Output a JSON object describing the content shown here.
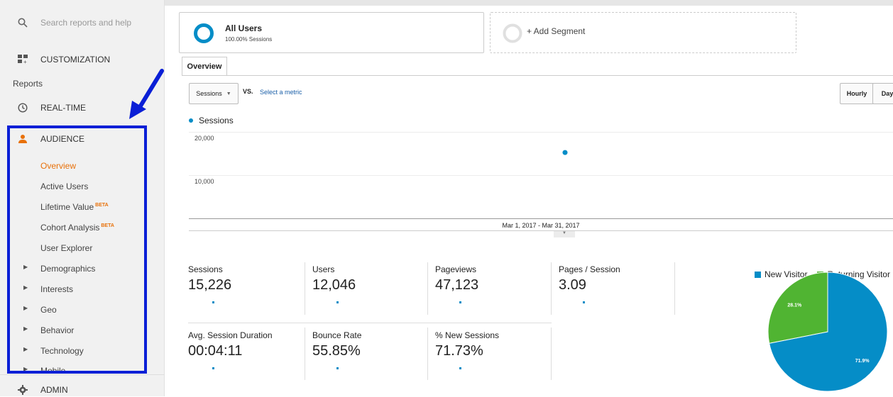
{
  "sidebar": {
    "search_placeholder": "Search reports and help",
    "customization": "CUSTOMIZATION",
    "reports_heading": "Reports",
    "realtime": "REAL-TIME",
    "audience": "AUDIENCE",
    "audience_items": [
      {
        "label": "Overview",
        "active": true
      },
      {
        "label": "Active Users"
      },
      {
        "label": "Lifetime Value",
        "badge": "BETA"
      },
      {
        "label": "Cohort Analysis",
        "badge": "BETA"
      },
      {
        "label": "User Explorer"
      },
      {
        "label": "Demographics"
      },
      {
        "label": "Interests"
      },
      {
        "label": "Geo"
      },
      {
        "label": "Behavior"
      },
      {
        "label": "Technology"
      },
      {
        "label": "Mobile"
      }
    ],
    "admin": "ADMIN"
  },
  "segments": {
    "all_users": "All Users",
    "all_users_sub": "100.00% Sessions",
    "add_segment": "+ Add Segment"
  },
  "tabs": {
    "overview": "Overview"
  },
  "controls": {
    "metric_select": "Sessions",
    "vs": "VS.",
    "select_metric": "Select a metric",
    "hourly": "Hourly",
    "day": "Day"
  },
  "chart_data": {
    "type": "line",
    "series": [
      {
        "name": "Sessions",
        "values": [
          15226
        ]
      }
    ],
    "x": [
      "Mar 2017"
    ],
    "yticks": [
      "20,000",
      "10,000"
    ],
    "ylim": [
      0,
      20000
    ],
    "date_range": "Mar 1, 2017 - Mar 31, 2017"
  },
  "metrics": [
    {
      "name": "Sessions",
      "value": "15,226"
    },
    {
      "name": "Users",
      "value": "12,046"
    },
    {
      "name": "Pageviews",
      "value": "47,123"
    },
    {
      "name": "Pages / Session",
      "value": "3.09"
    },
    {
      "name": "Avg. Session Duration",
      "value": "00:04:11"
    },
    {
      "name": "Bounce Rate",
      "value": "55.85%"
    },
    {
      "name": "% New Sessions",
      "value": "71.73%"
    }
  ],
  "pie": {
    "legend": [
      "New Visitor",
      "Returning Visitor"
    ],
    "colors": [
      "#058dc7",
      "#50b432"
    ],
    "values": [
      71.9,
      28.1
    ],
    "labels": [
      "71.9%",
      "28.1%"
    ]
  },
  "colors": {
    "accent_orange": "#e8710a",
    "series_blue": "#058dc7",
    "highlight_box": "#0a1fd6"
  }
}
